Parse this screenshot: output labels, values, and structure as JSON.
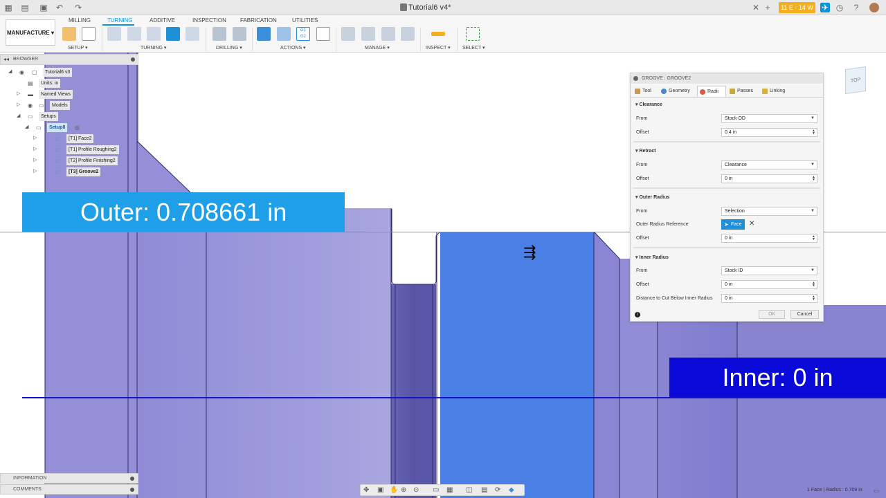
{
  "window": {
    "doc_title": "Tutorial6 v4*",
    "job_status": "11 E - 14 W"
  },
  "toolbar": {
    "workspace": "MANUFACTURE",
    "tabs": [
      "MILLING",
      "TURNING",
      "ADDITIVE",
      "INSPECTION",
      "FABRICATION",
      "UTILITIES"
    ],
    "active_tab": "TURNING",
    "groups": [
      "SETUP ▾",
      "TURNING ▾",
      "DRILLING ▾",
      "ACTIONS ▾",
      "MANAGE ▾",
      "INSPECT ▾",
      "SELECT ▾"
    ]
  },
  "browser": {
    "title": "BROWSER",
    "items": [
      {
        "label": "Tutorial6 v3"
      },
      {
        "label": "Units: in"
      },
      {
        "label": "Named Views"
      },
      {
        "label": "Models"
      },
      {
        "label": "Setups"
      },
      {
        "label": "Setup8"
      },
      {
        "label": "[T1] Face2"
      },
      {
        "label": "[T1] Profile Roughing2"
      },
      {
        "label": "[T2] Profile Finishing2"
      },
      {
        "label": "[T3] Groove2"
      }
    ]
  },
  "panels": {
    "information": "INFORMATION",
    "comments": "COMMENTS"
  },
  "overlay": {
    "outer": "Outer: 0.708661 in",
    "inner": "Inner: 0 in"
  },
  "dialog": {
    "title": "GROOVE : GROOVE2",
    "tabs": [
      "Tool",
      "Geometry",
      "Radii",
      "Passes",
      "Linking"
    ],
    "active_tab": "Radii",
    "clearance": {
      "header": "Clearance",
      "from_label": "From",
      "from_value": "Stock OD",
      "offset_label": "Offset",
      "offset_value": "0.4 in"
    },
    "retract": {
      "header": "Retract",
      "from_label": "From",
      "from_value": "Clearance",
      "offset_label": "Offset",
      "offset_value": "0 in"
    },
    "outer_radius": {
      "header": "Outer Radius",
      "from_label": "From",
      "from_value": "Selection",
      "ref_label": "Outer Radius Reference",
      "ref_value": "Face",
      "offset_label": "Offset",
      "offset_value": "0 in"
    },
    "inner_radius": {
      "header": "Inner Radius",
      "from_label": "From",
      "from_value": "Stock ID",
      "offset_label": "Offset",
      "offset_value": "0 in",
      "below_label": "Distance to Cut Below Inner Radius",
      "below_value": "0 in"
    },
    "ok": "OK",
    "cancel": "Cancel"
  },
  "status": {
    "selection": "1 Face | Radius : 0.709 in"
  },
  "viewcube": {
    "face": "TOP"
  }
}
